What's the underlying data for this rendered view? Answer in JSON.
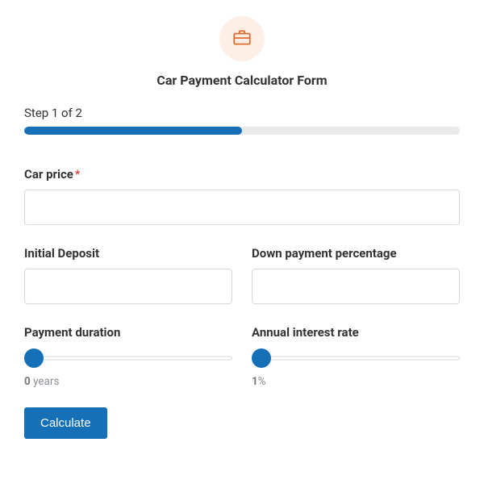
{
  "header": {
    "icon": "briefcase-icon",
    "title": "Car Payment Calculator Form"
  },
  "progress": {
    "label": "Step 1 of 2",
    "percent": 50
  },
  "fields": {
    "car_price": {
      "label": "Car price",
      "required_mark": "*"
    },
    "initial_deposit": {
      "label": "Initial Deposit"
    },
    "down_payment_pct": {
      "label": "Down payment percentage"
    },
    "payment_duration": {
      "label": "Payment duration",
      "value": "0",
      "unit": " years"
    },
    "annual_rate": {
      "label": "Annual interest rate",
      "value": "1",
      "unit": "%"
    }
  },
  "actions": {
    "calculate": "Calculate"
  },
  "colors": {
    "accent": "#1670b8",
    "icon_bg": "#fdeee6",
    "icon_stroke": "#e06b2a",
    "required": "#e03131"
  }
}
